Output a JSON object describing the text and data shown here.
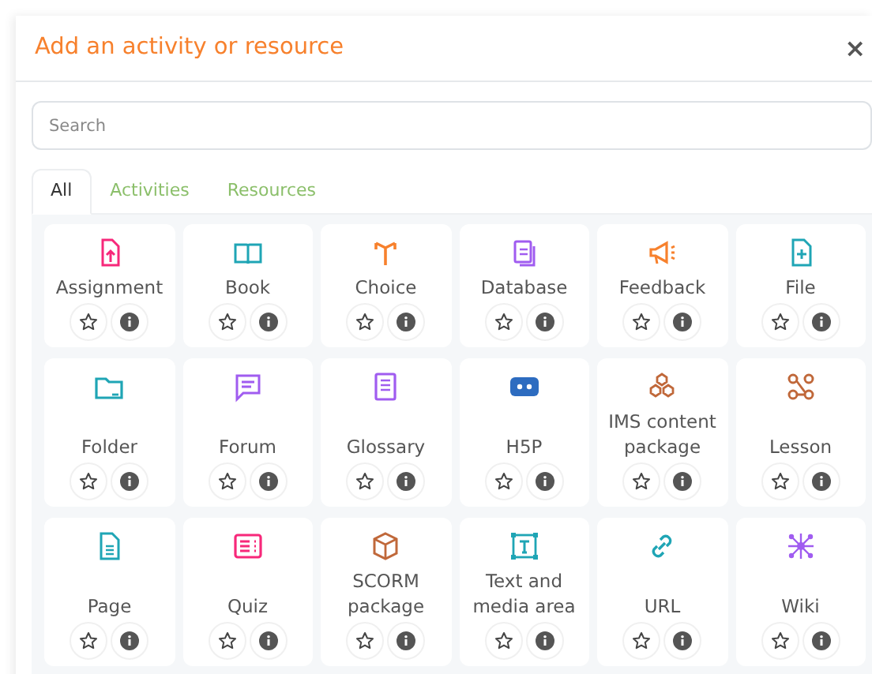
{
  "dialog": {
    "title": "Add an activity or resource",
    "close": "×"
  },
  "search": {
    "placeholder": "Search"
  },
  "tabs": [
    {
      "label": "All",
      "selected": true
    },
    {
      "label": "Activities",
      "selected": false
    },
    {
      "label": "Resources",
      "selected": false
    }
  ],
  "modules": [
    {
      "name": "Assignment",
      "color": "#f7287a"
    },
    {
      "name": "Book",
      "color": "#1fa5b5"
    },
    {
      "name": "Choice",
      "color": "#f7812d"
    },
    {
      "name": "Database",
      "color": "#a05cf0"
    },
    {
      "name": "Feedback",
      "color": "#f7812d"
    },
    {
      "name": "File",
      "color": "#1fa5b5"
    },
    {
      "name": "Folder",
      "color": "#1fa5b5"
    },
    {
      "name": "Forum",
      "color": "#a05cf0"
    },
    {
      "name": "Glossary",
      "color": "#a05cf0"
    },
    {
      "name": "H5P",
      "color": "#2d6cc0"
    },
    {
      "name": "IMS content package",
      "color": "#c0683a"
    },
    {
      "name": "Lesson",
      "color": "#c0683a"
    },
    {
      "name": "Page",
      "color": "#1fa5b5"
    },
    {
      "name": "Quiz",
      "color": "#f7287a"
    },
    {
      "name": "SCORM package",
      "color": "#c0683a"
    },
    {
      "name": "Text and media area",
      "color": "#1fa5b5"
    },
    {
      "name": "URL",
      "color": "#1fa5b5"
    },
    {
      "name": "Wiki",
      "color": "#a05cf0"
    }
  ]
}
